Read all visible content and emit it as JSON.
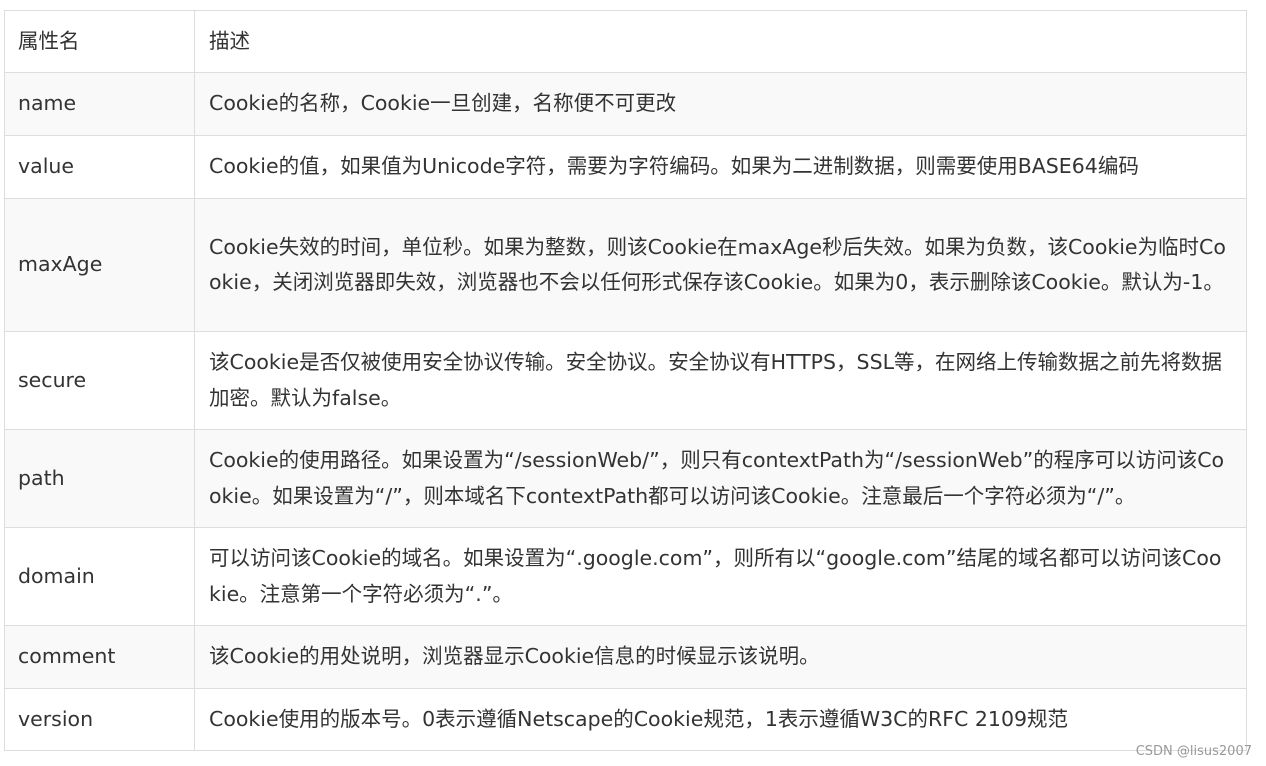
{
  "table": {
    "headers": {
      "name": "属性名",
      "description": "描述"
    },
    "rows": [
      {
        "name": "name",
        "description": "Cookie的名称，Cookie一旦创建，名称便不可更改"
      },
      {
        "name": "value",
        "description": "Cookie的值，如果值为Unicode字符，需要为字符编码。如果为二进制数据，则需要使用BASE64编码"
      },
      {
        "name": "maxAge",
        "description": "Cookie失效的时间，单位秒。如果为整数，则该Cookie在maxAge秒后失效。如果为负数，该Cookie为临时Cookie，关闭浏览器即失效，浏览器也不会以任何形式保存该Cookie。如果为0，表示删除该Cookie。默认为-1。"
      },
      {
        "name": "secure",
        "description": "该Cookie是否仅被使用安全协议传输。安全协议。安全协议有HTTPS，SSL等，在网络上传输数据之前先将数据加密。默认为false。"
      },
      {
        "name": "path",
        "description": "Cookie的使用路径。如果设置为“/sessionWeb/”，则只有contextPath为“/sessionWeb”的程序可以访问该Cookie。如果设置为“/”，则本域名下contextPath都可以访问该Cookie。注意最后一个字符必须为“/”。"
      },
      {
        "name": "domain",
        "description": "可以访问该Cookie的域名。如果设置为“.google.com”，则所有以“google.com”结尾的域名都可以访问该Cookie。注意第一个字符必须为“.”。"
      },
      {
        "name": "comment",
        "description": "该Cookie的用处说明，浏览器显示Cookie信息的时候显示该说明。"
      },
      {
        "name": "version",
        "description": "Cookie使用的版本号。0表示遵循Netscape的Cookie规范，1表示遵循W3C的RFC 2109规范"
      }
    ]
  },
  "watermark": "CSDN @lisus2007"
}
